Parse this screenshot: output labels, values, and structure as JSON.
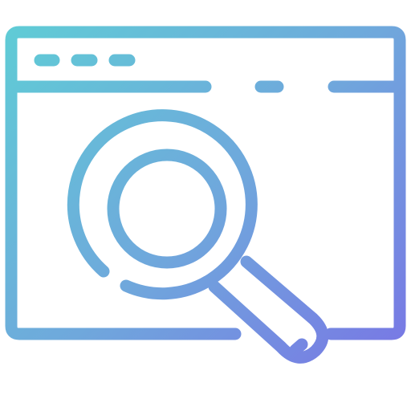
{
  "icon": {
    "name": "browser-search-icon",
    "colors": {
      "gradient_start": "#5ECFD5",
      "gradient_mid": "#6FA8DC",
      "gradient_end": "#7A6FE6",
      "background": "#FFFFFF"
    }
  }
}
